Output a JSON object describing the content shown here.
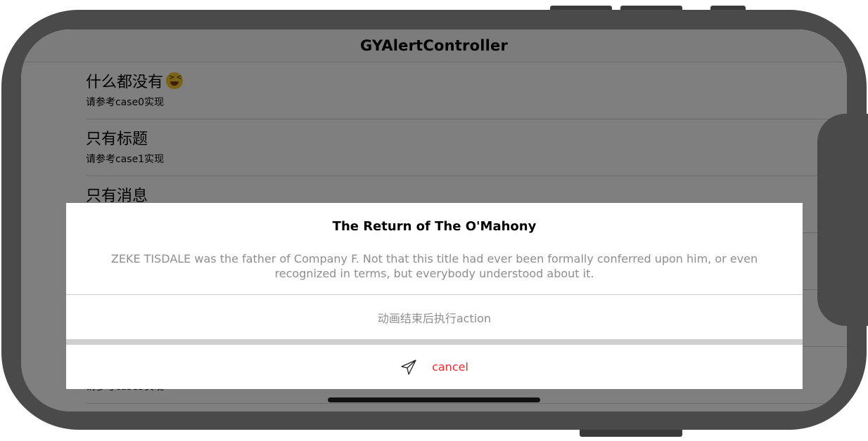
{
  "nav": {
    "title": "GYAlertController"
  },
  "list": {
    "rows": [
      {
        "title": "什么都没有",
        "subtitle": "请参考case0实现"
      },
      {
        "title": "只有标题",
        "subtitle": "请参考case1实现"
      },
      {
        "title": "只有消息",
        "subtitle": ""
      },
      {
        "title": "",
        "subtitle": ""
      },
      {
        "title": "",
        "subtitle": ""
      },
      {
        "title": "",
        "subtitle": "请参考case5实现"
      }
    ]
  },
  "alert": {
    "title": "The Return of The O'Mahony",
    "message": "ZEKE TISDALE was the father of Company F. Not that this title had ever been formally conferred upon him, or even recognized in terms, but everybody understood about it.",
    "action_label": "动画结束后执行action",
    "cancel_label": "cancel",
    "cancel_icon": "paper-plane-icon"
  },
  "colors": {
    "frame": "#4a4a4a",
    "overlay": "rgba(0,0,0,0.5)",
    "cancel_text": "#e53030",
    "secondary_text": "#8e8e8e"
  }
}
